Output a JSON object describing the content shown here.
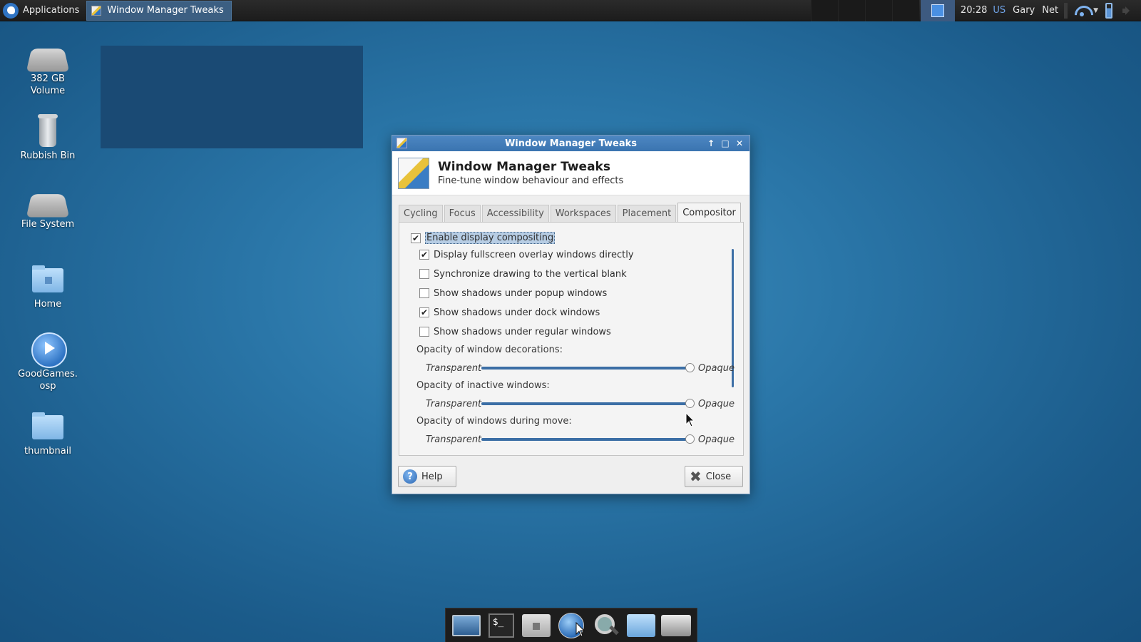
{
  "panel": {
    "applications_label": "Applications",
    "task_label": "Window Manager Tweaks",
    "clock": "20:28",
    "keyboard_layout": "US",
    "user": "Gary",
    "network": "Net"
  },
  "desktop": {
    "icons": [
      {
        "label_line1": "382 GB",
        "label_line2": "Volume",
        "icon": "drive-icon"
      },
      {
        "label_line1": "Rubbish Bin",
        "label_line2": "",
        "icon": "trash-icon"
      },
      {
        "label_line1": "File System",
        "label_line2": "",
        "icon": "drive-icon"
      },
      {
        "label_line1": "Home",
        "label_line2": "",
        "icon": "home-folder-icon"
      },
      {
        "label_line1": "GoodGames.",
        "label_line2": "osp",
        "icon": "media-play-icon"
      },
      {
        "label_line1": "thumbnail",
        "label_line2": "",
        "icon": "folder-icon"
      }
    ]
  },
  "dialog": {
    "window_title": "Window Manager Tweaks",
    "header_title": "Window Manager Tweaks",
    "header_subtitle": "Fine-tune window behaviour and effects",
    "tabs": [
      "Cycling",
      "Focus",
      "Accessibility",
      "Workspaces",
      "Placement",
      "Compositor"
    ],
    "active_tab": "Compositor",
    "compositor": {
      "enable_label": "Enable display compositing",
      "enable_checked": true,
      "options": [
        {
          "label": "Display fullscreen overlay windows directly",
          "checked": true,
          "mark": "✔"
        },
        {
          "label": "Synchronize drawing to the vertical blank",
          "checked": false,
          "mark": ""
        },
        {
          "label": "Show shadows under popup windows",
          "checked": false,
          "mark": ""
        },
        {
          "label": "Show shadows under dock windows",
          "checked": true,
          "mark": "✔"
        },
        {
          "label": "Show shadows under regular windows",
          "checked": false,
          "mark": ""
        }
      ],
      "opacity_sliders": [
        {
          "label": "Opacity of window decorations:",
          "min_label": "Transparent",
          "max_label": "Opaque",
          "value_percent": 100
        },
        {
          "label": "Opacity of inactive windows:",
          "min_label": "Transparent",
          "max_label": "Opaque",
          "value_percent": 100
        },
        {
          "label": "Opacity of windows during move:",
          "min_label": "Transparent",
          "max_label": "Opaque",
          "value_percent": 100
        }
      ]
    },
    "help_label": "Help",
    "close_label": "Close"
  },
  "dock": {
    "items": [
      "desktop-icon",
      "terminal-icon",
      "home-icon",
      "web-browser-icon",
      "search-icon",
      "file-manager-icon",
      "drive-icon"
    ],
    "terminal_glyph": "$_"
  }
}
